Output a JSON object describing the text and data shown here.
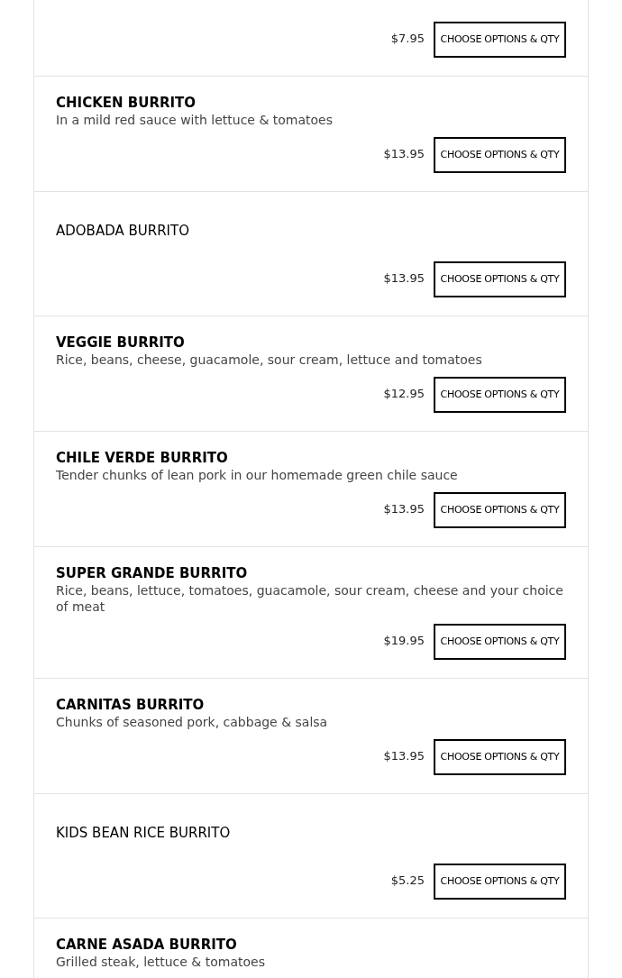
{
  "menu_items": [
    {
      "price": "$7.95",
      "button": "CHOOSE OPTIONS & QTY"
    },
    {
      "name": "CHICKEN BURRITO",
      "bold": true,
      "description": "In a mild red sauce with lettuce & tomatoes",
      "price": "$13.95",
      "button": "CHOOSE OPTIONS & QTY"
    },
    {
      "name": "ADOBADA BURRITO",
      "bold": false,
      "price": "$13.95",
      "button": "CHOOSE OPTIONS & QTY"
    },
    {
      "name": "VEGGIE BURRITO",
      "bold": true,
      "description": "Rice, beans, cheese, guacamole, sour cream, lettuce and tomatoes",
      "price": "$12.95",
      "button": "CHOOSE OPTIONS & QTY"
    },
    {
      "name": "CHILE VERDE BURRITO",
      "bold": true,
      "description": "Tender chunks of lean pork in our homemade green chile sauce",
      "price": "$13.95",
      "button": "CHOOSE OPTIONS & QTY"
    },
    {
      "name": "SUPER GRANDE BURRITO",
      "bold": true,
      "description": "Rice, beans, lettuce, tomatoes, guacamole, sour cream, cheese and your choice of meat",
      "price": "$19.95",
      "button": "CHOOSE OPTIONS & QTY"
    },
    {
      "name": "CARNITAS BURRITO",
      "bold": true,
      "description": "Chunks of seasoned pork, cabbage & salsa",
      "price": "$13.95",
      "button": "CHOOSE OPTIONS & QTY"
    },
    {
      "name": "KIDS BEAN RICE BURRITO",
      "bold": false,
      "price": "$5.25",
      "button": "CHOOSE OPTIONS & QTY"
    },
    {
      "name": "CARNE ASADA BURRITO",
      "bold": true,
      "description": "Grilled steak, lettuce & tomatoes"
    }
  ]
}
